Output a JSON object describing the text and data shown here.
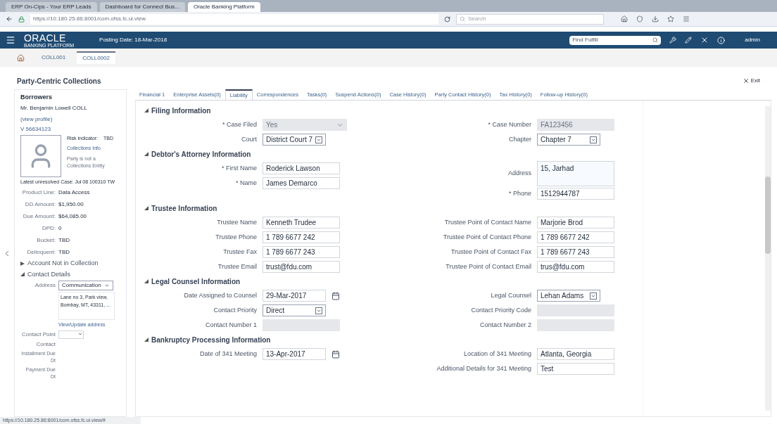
{
  "browser": {
    "tabs": [
      {
        "label": "ERP On-Cips - Your ERP Leads",
        "selected": false
      },
      {
        "label": "Dashboard for Connect Bus...",
        "selected": false
      },
      {
        "label": "Oracle Banking Platform",
        "selected": true
      }
    ],
    "address": "https://10.180.25.86:8001/com.ofss.fc.ui.view",
    "search_placeholder": "Search"
  },
  "header": {
    "logo": "ORACLE",
    "logo_sub": "BANKING PLATFORM",
    "posting_date": "Posting Date: 18-Mar-2018",
    "search_value": "Find Fulfill",
    "user": "admin"
  },
  "breadcrumbs": [
    {
      "label": "COLL001",
      "selected": false
    },
    {
      "label": "COLL0002",
      "selected": true
    }
  ],
  "page_title": "Party-Centric Collections",
  "exit_label": "Exit",
  "borrower": {
    "title": "Borrowers",
    "name": "Mr. Benjamin Lowell COLL",
    "profile_link": "(view profile)",
    "id": "V 56634123",
    "risk_label": "Risk indicator:",
    "risk_value": "TBD",
    "collections_link": "Collections Info",
    "note": "Party is not a Collections Entity",
    "latest_case": "Latest unresolved Case: Jul 08 100310 TW",
    "facts": [
      {
        "label": "Product Line:",
        "value": "Data Access"
      },
      {
        "label": "DD Amount:",
        "value": "$1,950.00"
      },
      {
        "label": "Due Amount:",
        "value": "$64,085.00"
      },
      {
        "label": "DPD:",
        "value": "0"
      },
      {
        "label": "Bucket:",
        "value": "TBD"
      },
      {
        "label": "Delinquent:",
        "value": "TBD"
      }
    ],
    "groups": [
      {
        "label": "Account Not in Collection",
        "expanded": false
      },
      {
        "label": "Contact Details",
        "expanded": true
      }
    ],
    "address_label": "Address",
    "address_type": "Communication",
    "address_text": "Lane no 3, Park view, Bombay, MT, 43311, ...",
    "update_link": "View/Update address",
    "contact_point_label": "Contact Point",
    "contact_label": "Contact",
    "extra_labels": [
      "Installment Due Dt",
      "Payment Due Dt"
    ]
  },
  "tabs": [
    {
      "label": "Financial 1",
      "selected": false
    },
    {
      "label": "Enterprise Assets(0)",
      "selected": false
    },
    {
      "label": "Liability",
      "selected": true
    },
    {
      "label": "Correspondences",
      "selected": false
    },
    {
      "label": "Tasks(0)",
      "selected": false
    },
    {
      "label": "Suspend Actions(0)",
      "selected": false
    },
    {
      "label": "Case History(0)",
      "selected": false
    },
    {
      "label": "Party Contact History(0)",
      "selected": false
    },
    {
      "label": "Tax History(0)",
      "selected": false
    },
    {
      "label": "Follow-up History(0)",
      "selected": false
    }
  ],
  "sections": [
    {
      "title": "Filing Information",
      "expanded": true,
      "left": [
        {
          "label": "* Case Filed",
          "kind": "disabled-select",
          "value": "Yes"
        },
        {
          "label": "Court",
          "kind": "select",
          "value": "District Court 7"
        }
      ],
      "right": [
        {
          "label": "* Case Number",
          "kind": "disabled",
          "value": "FA123456"
        },
        {
          "label": "Chapter",
          "kind": "select",
          "value": "Chapter 7"
        }
      ]
    },
    {
      "title": "Debtor's Attorney Information",
      "expanded": true,
      "left": [
        {
          "label": "* First Name",
          "kind": "text",
          "value": "Roderick Lawson"
        },
        {
          "label": "* Name",
          "kind": "text",
          "value": "James Demarco"
        }
      ],
      "right": [
        {
          "label": "Address",
          "kind": "textarea",
          "value": "15, Jarhad"
        },
        {
          "label": "* Phone",
          "kind": "text",
          "value": "1512944787"
        }
      ]
    },
    {
      "title": "Trustee Information",
      "expanded": true,
      "left": [
        {
          "label": "Trustee Name",
          "kind": "text",
          "value": "Kenneth Trudee"
        },
        {
          "label": "Trustee Phone",
          "kind": "text",
          "value": "1 789 6677 242"
        },
        {
          "label": "Trustee Fax",
          "kind": "text",
          "value": "1 789 6677 243"
        },
        {
          "label": "Trustee Email",
          "kind": "text",
          "value": "trust@fdu.com"
        }
      ],
      "right": [
        {
          "label": "Trustee Point of Contact Name",
          "kind": "text",
          "value": "Marjorie Brod"
        },
        {
          "label": "Trustee Point of Contact Phone",
          "kind": "text",
          "value": "1 789 6677 242"
        },
        {
          "label": "Trustee Point of Contact Fax",
          "kind": "text",
          "value": "1 789 6677 243"
        },
        {
          "label": "Trustee Point of Contact Email",
          "kind": "text",
          "value": "trus@fdu.com"
        }
      ]
    },
    {
      "title": "Legal Counsel Information",
      "expanded": true,
      "left": [
        {
          "label": "Date Assigned to Counsel",
          "kind": "date",
          "value": "29-Mar-2017"
        },
        {
          "label": "Contact Priority",
          "kind": "select",
          "value": "Direct"
        },
        {
          "label": "Contact Number 1",
          "kind": "disabled"
        }
      ],
      "right": [
        {
          "label": "Legal Counsel",
          "kind": "select",
          "value": "Lehan Adams"
        },
        {
          "label": "Contact Priority Code",
          "kind": "disabled"
        },
        {
          "label": "Contact Number 2",
          "kind": "disabled"
        }
      ]
    },
    {
      "title": "Bankruptcy Processing Information",
      "expanded": true,
      "left": [
        {
          "label": "Date of 341 Meeting",
          "kind": "date",
          "value": "13-Apr-2017"
        }
      ],
      "right": [
        {
          "label": "Location of 341 Meeting",
          "kind": "text",
          "value": "Atlanta, Georgia"
        },
        {
          "label": "Additional Details for 341 Meeting",
          "kind": "text",
          "value": "Test"
        }
      ]
    }
  ],
  "status_bar": "https://10.180.25.86:8001/com.ofss.fc.ui.view/#"
}
